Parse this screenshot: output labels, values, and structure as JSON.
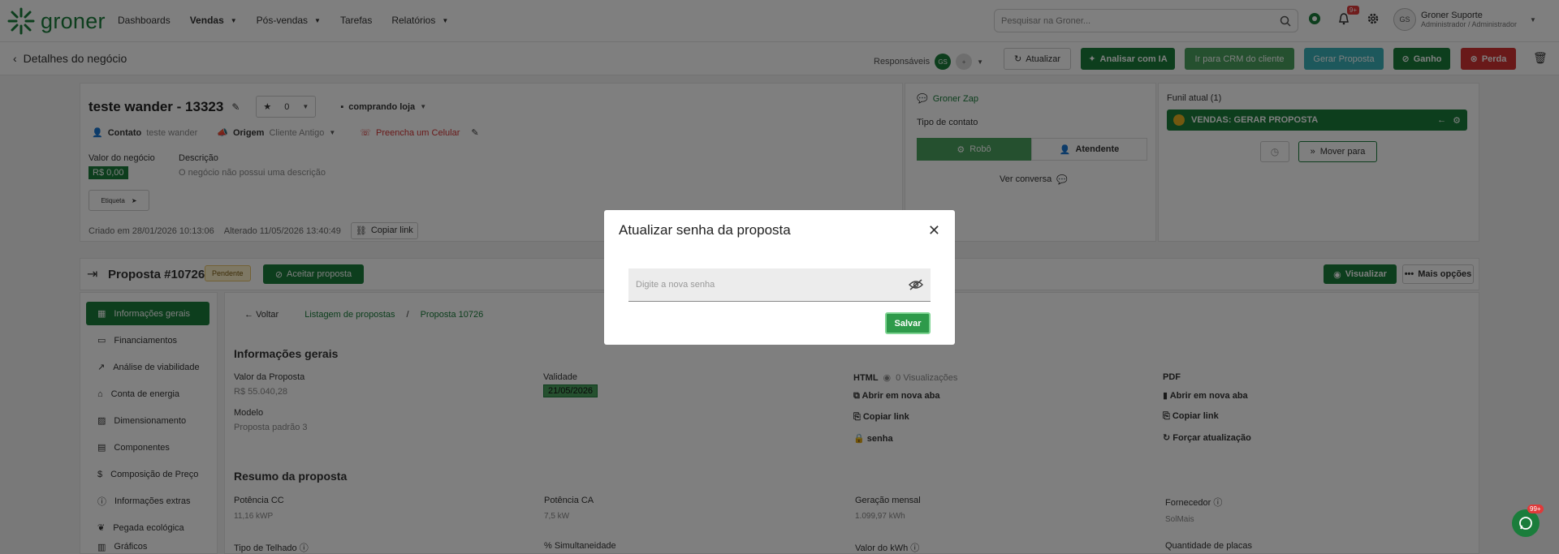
{
  "logo": {
    "text": "groner"
  },
  "nav": {
    "dashboards": "Dashboards",
    "vendas": "Vendas",
    "posvendas": "Pós-vendas",
    "tarefas": "Tarefas",
    "relatorios": "Relatórios"
  },
  "search": {
    "placeholder": "Pesquisar na Groner..."
  },
  "notifications": {
    "badge": "9+"
  },
  "user": {
    "avatar": "GS",
    "name": "Groner Suporte",
    "role": "Administrador / Administrador"
  },
  "subbar": {
    "title": "Detalhes do negócio",
    "responsaveis": "Responsáveis",
    "resp_avatar": "GS",
    "resp_avatar2": "+",
    "atualizar": "Atualizar",
    "analisar": "Analisar com IA",
    "crm": "Ir para CRM do cliente",
    "gerar": "Gerar Proposta",
    "ganho": "Ganho",
    "perda": "Perda"
  },
  "deal": {
    "title": "teste wander - 13323",
    "stars": "0",
    "tag": "comprando loja",
    "contato_label": "Contato",
    "contato_value": "teste wander",
    "origem_label": "Origem",
    "origem_value": "Cliente Antigo",
    "celular": "Preencha um Celular",
    "valor_label": "Valor do negócio",
    "valor_value": "R$ 0,00",
    "descricao_label": "Descrição",
    "descricao_value": "O negócio não possui uma descrição",
    "etiqueta": "Etiqueta",
    "criado": "Criado em 28/01/2026 10:13:06",
    "alterado": "Alterado 11/05/2026 13:40:49",
    "copiar": "Copiar link"
  },
  "zap": {
    "title": "Groner Zap",
    "tipo": "Tipo de contato",
    "robo": "Robô",
    "atendente": "Atendente",
    "ver": "Ver conversa"
  },
  "funil": {
    "title": "Funil atual (1)",
    "stage": "VENDAS: GERAR PROPOSTA",
    "mover": "Mover para"
  },
  "proposta": {
    "title": "Proposta #10726",
    "status": "Pendente",
    "aceitar": "Aceitar proposta",
    "visualizar": "Visualizar",
    "mais": "Mais opções"
  },
  "sidebar": {
    "items": [
      {
        "label": "Informações gerais"
      },
      {
        "label": "Financiamentos"
      },
      {
        "label": "Análise de viabilidade"
      },
      {
        "label": "Conta de energia"
      },
      {
        "label": "Dimensionamento"
      },
      {
        "label": "Componentes"
      },
      {
        "label": "Composição de Preço"
      },
      {
        "label": "Informações extras"
      },
      {
        "label": "Pegada ecológica"
      },
      {
        "label": "Gráficos"
      }
    ]
  },
  "breadcrumb": {
    "voltar": "Voltar",
    "listagem": "Listagem de propostas",
    "sep": "/",
    "current": "Proposta 10726"
  },
  "info": {
    "title": "Informações gerais",
    "valor_label": "Valor da Proposta",
    "valor_value": "R$ 55.040,28",
    "validade_label": "Validade",
    "validade_value": "21/05/2026",
    "modelo_label": "Modelo",
    "modelo_value": "Proposta padrão 3",
    "html_label": "HTML",
    "views": "0 Visualizações",
    "abrir": "Abrir em nova aba",
    "copiar": "Copiar link",
    "senha": "senha",
    "pdf_label": "PDF",
    "pdf_abrir": "Abrir em nova aba",
    "pdf_copiar": "Copiar link",
    "forcar": "Forçar atualização"
  },
  "resumo": {
    "title": "Resumo da proposta",
    "pcc_label": "Potência CC",
    "pcc_value": "11,16 kWP",
    "pca_label": "Potência CA",
    "pca_value": "7,5 kW",
    "ger_label": "Geração mensal",
    "ger_value": "1.099,97 kWh",
    "forn_label": "Fornecedor",
    "forn_value": "SolMais",
    "telhado_label": "Tipo de Telhado",
    "simult_label": "% Simultaneidade",
    "kwh_label": "Valor do kWh",
    "placas_label": "Quantidade de placas"
  },
  "modal": {
    "title": "Atualizar senha da proposta",
    "placeholder": "Digite a nova senha",
    "save": "Salvar"
  },
  "whatsapp": {
    "badge": "99+"
  }
}
